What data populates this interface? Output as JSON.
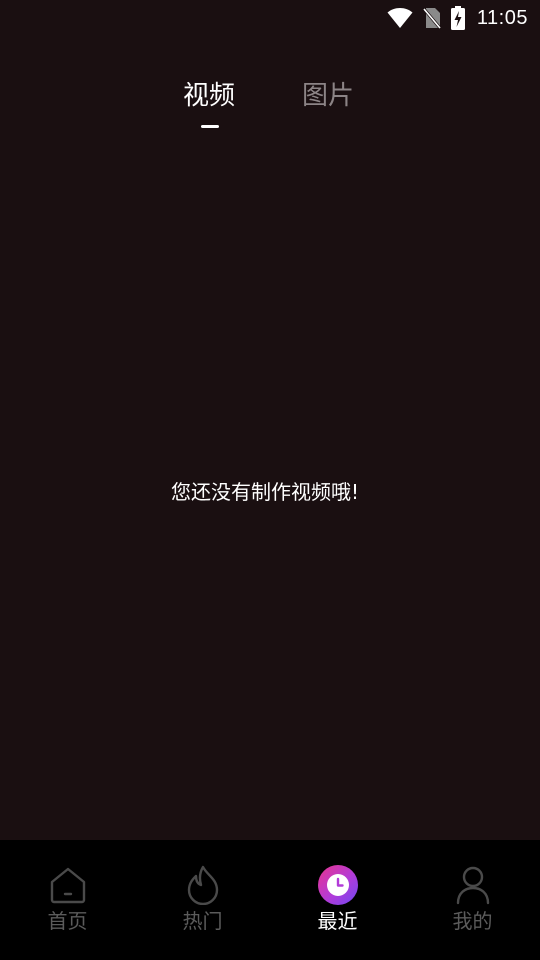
{
  "status_bar": {
    "time": "11:05",
    "icons": [
      "wifi-icon",
      "no-sim-icon",
      "battery-charging-icon"
    ]
  },
  "tabs": [
    {
      "label": "视频",
      "active": true
    },
    {
      "label": "图片",
      "active": false
    }
  ],
  "empty_state": {
    "message": "您还没有制作视频哦!"
  },
  "bottom_nav": {
    "items": [
      {
        "label": "首页",
        "icon": "home-icon",
        "active": false
      },
      {
        "label": "热门",
        "icon": "flame-icon",
        "active": false
      },
      {
        "label": "最近",
        "icon": "clock-icon",
        "active": true
      },
      {
        "label": "我的",
        "icon": "person-icon",
        "active": false
      }
    ]
  },
  "colors": {
    "background": "#1a0f11",
    "nav_background": "#000000",
    "active_text": "#ffffff",
    "inactive_tab": "#8c8486",
    "inactive_nav": "#5b5b5b",
    "accent_gradient": [
      "#e8358e",
      "#b23bd8",
      "#6f48f2"
    ]
  }
}
